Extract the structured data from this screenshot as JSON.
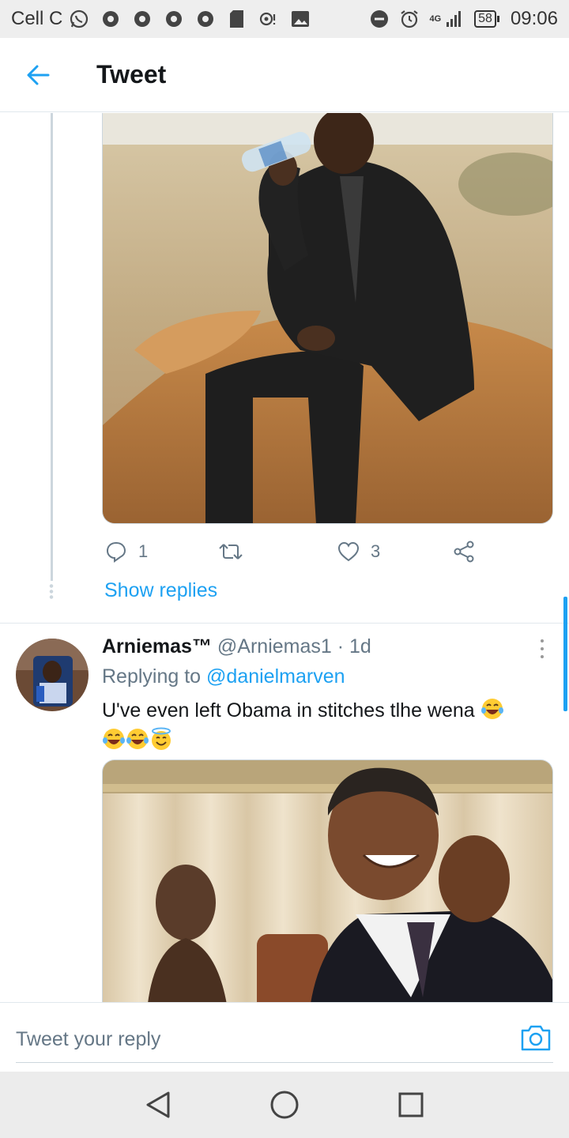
{
  "status_bar": {
    "carrier": "Cell C",
    "network": "4G",
    "battery": "58",
    "time": "09:06"
  },
  "header": {
    "title": "Tweet"
  },
  "previous_tweet": {
    "reply_count": "1",
    "like_count": "3",
    "show_replies_label": "Show replies"
  },
  "reply_tweet": {
    "display_name": "Arniemas™",
    "handle": "@Arniemas1",
    "separator": "·",
    "age": "1d",
    "replying_to_label": "Replying to",
    "replying_to_handle": "@danielmarven",
    "text": "U've even left Obama in stitches tlhe wena"
  },
  "reply_bar": {
    "placeholder": "Tweet your reply"
  },
  "colors": {
    "accent": "#1da1f2",
    "secondary_text": "#657786",
    "status_bar_bg": "#eeeeee",
    "nav_bar_bg": "#ececec"
  }
}
